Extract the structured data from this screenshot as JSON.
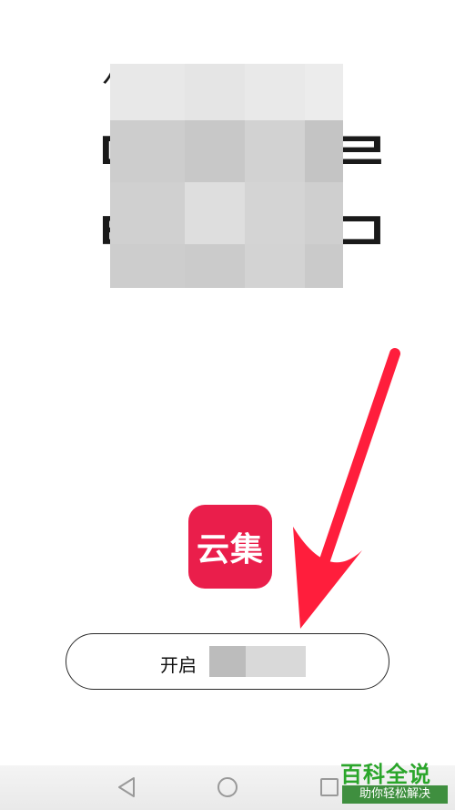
{
  "screen": {
    "logo_text": "云集",
    "primary_button": {
      "label": "开启"
    },
    "nav": {
      "back_icon": "back-triangle-icon",
      "home_icon": "home-circle-icon",
      "recent_icon": "recent-apps-square-icon"
    }
  },
  "watermark": {
    "title": "百科全说",
    "subtitle": "助你轻松解决"
  },
  "colors": {
    "brand": "#ea1e4b",
    "arrow": "#ff1e3c",
    "watermark_green": "#2aa52a"
  }
}
